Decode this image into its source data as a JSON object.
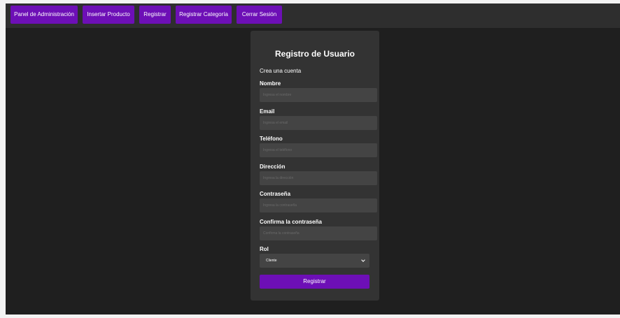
{
  "nav": {
    "items": [
      {
        "label": "Panel de Administración"
      },
      {
        "label": "Insertar Producto"
      },
      {
        "label": "Registrar"
      },
      {
        "label": "Registrar Categoría"
      },
      {
        "label": "Cerrar Sesión"
      }
    ]
  },
  "form": {
    "title": "Registro de Usuario",
    "subtitle": "Crea una cuenta",
    "fields": [
      {
        "label": "Nombre",
        "placeholder": "Ingresa el nombre",
        "value": ""
      },
      {
        "label": "Email",
        "placeholder": "Ingresa el email",
        "value": ""
      },
      {
        "label": "Teléfono",
        "placeholder": "Ingresa el teléfono",
        "value": ""
      },
      {
        "label": "Dirección",
        "placeholder": "Ingresa la dirección",
        "value": ""
      },
      {
        "label": "Contraseña",
        "placeholder": "Ingresa la contraseña",
        "value": ""
      },
      {
        "label": "Confirma la contraseña",
        "placeholder": "Confirma la contraseña",
        "value": ""
      }
    ],
    "role": {
      "label": "Rol",
      "selected": "Cliente"
    },
    "submit_label": "Registrar"
  },
  "colors": {
    "accent": "#6d0fb6",
    "background": "#1f1f1f",
    "navbar": "#2e2e2e",
    "card": "#333333",
    "input": "#444444"
  },
  "icons": {
    "select_arrow": "chevron-down-icon"
  }
}
